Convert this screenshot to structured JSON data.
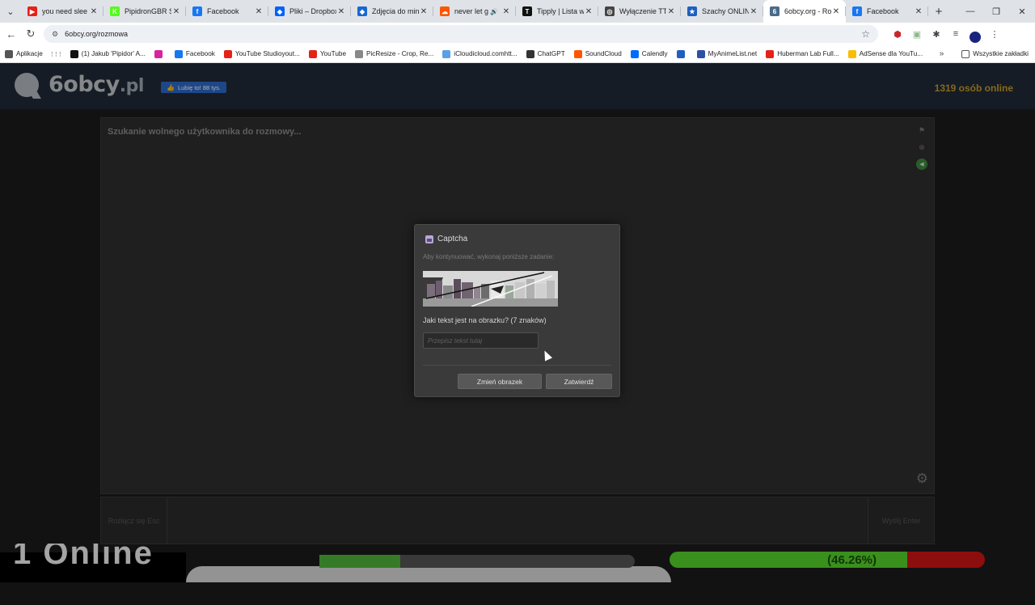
{
  "browser": {
    "tabs": [
      {
        "title": "you need slee",
        "fav_color": "#e62117",
        "fav_char": "▶"
      },
      {
        "title": "PipidronGBR S",
        "fav_color": "#53fc18",
        "fav_char": "K"
      },
      {
        "title": "Facebook",
        "fav_color": "#1877f2",
        "fav_char": "f"
      },
      {
        "title": "Pliki – Dropbox",
        "fav_color": "#0061fe",
        "fav_char": "◆"
      },
      {
        "title": "Zdjęcia do min",
        "fav_color": "#1967d2",
        "fav_char": "◆"
      },
      {
        "title": "never let g",
        "fav_color": "#ff5500",
        "fav_char": "☁"
      },
      {
        "title": "Tipply | Lista w",
        "fav_color": "#111111",
        "fav_char": "T"
      },
      {
        "title": "Wyłączenie TT",
        "fav_color": "#444444",
        "fav_char": "◎"
      },
      {
        "title": "Szachy ONLIN",
        "fav_color": "#1f5fbf",
        "fav_char": "★"
      },
      {
        "title": "6obcy.org - Ro",
        "fav_color": "#4a6a8a",
        "fav_char": "6"
      },
      {
        "title": "Facebook",
        "fav_color": "#1877f2",
        "fav_char": "f"
      }
    ],
    "url": "6obcy.org/rozmowa",
    "bookmarks": [
      {
        "label": "Aplikacje",
        "color": "#555555"
      },
      {
        "label": "(1) Jakub 'Pipidor' A...",
        "color": "#111111"
      },
      {
        "label": "",
        "color": "#d6249f"
      },
      {
        "label": "Facebook",
        "color": "#1877f2"
      },
      {
        "label": "YouTube Studioyout...",
        "color": "#e62117"
      },
      {
        "label": "YouTube",
        "color": "#e62117"
      },
      {
        "label": "PicResize - Crop, Re...",
        "color": "#888888"
      },
      {
        "label": "iCloudicloud.comhtt...",
        "color": "#5aa0e6"
      },
      {
        "label": "ChatGPT",
        "color": "#333333"
      },
      {
        "label": "SoundCloud",
        "color": "#ff5500"
      },
      {
        "label": "Calendly",
        "color": "#006bff"
      },
      {
        "label": "",
        "color": "#1f5fbf"
      },
      {
        "label": "MyAnimeList.net",
        "color": "#2e51a2"
      },
      {
        "label": "Huberman Lab Full...",
        "color": "#e62117"
      },
      {
        "label": "AdSense dla YouTu...",
        "color": "#fbbc04"
      }
    ],
    "all_bookmarks": "Wszystkie zakładki"
  },
  "site": {
    "logo": "6obcy",
    "logo_domain": ".pl",
    "like_button": "Lubię to! 88 tys.",
    "online_count": "1319 osób online",
    "status": "Szukanie wolnego użytkownika do rozmowy...",
    "disconnect_label": "Rozłącz się Esc",
    "send_label": "Wyślij Enter"
  },
  "captcha": {
    "title": "Captcha",
    "subtitle": "Aby kontynuować, wykonaj poniższe zadanie:",
    "question": "Jaki tekst jest na obrazku? (7 znaków)",
    "placeholder": "Przepisz tekst tutaj",
    "change_button": "Zmień obrazek",
    "confirm_button": "Zatwierdź"
  },
  "stream_overlay": {
    "left_text": "1 Online",
    "percent": "(46.26%)"
  }
}
